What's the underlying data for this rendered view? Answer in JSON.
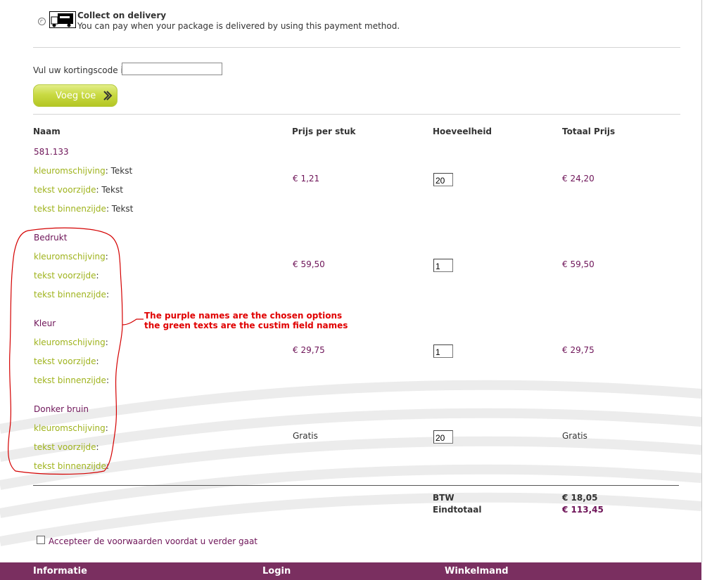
{
  "payment": {
    "title": "Collect on delivery",
    "description": "You can pay when your package is delivered by using this payment method."
  },
  "discount": {
    "label": "Vul uw kortingscode in",
    "value": "",
    "button_label": "Voeg toe"
  },
  "table": {
    "headers": [
      "Naam",
      "Prijs per stuk",
      "Hoeveelheid",
      "Totaal Prijs"
    ],
    "rows": [
      {
        "name": "581.133",
        "fields": [
          {
            "label": "kleuromschijving",
            "value": "Tekst"
          },
          {
            "label": "tekst voorzijde",
            "value": "Tekst"
          },
          {
            "label": "tekst binnenzijde",
            "value": "Tekst"
          }
        ],
        "price": "€ 1,21",
        "qty": "20",
        "total": "€ 24,20"
      },
      {
        "name": "Bedrukt",
        "fields": [
          {
            "label": "kleuromschijving",
            "value": ""
          },
          {
            "label": "tekst voorzijde",
            "value": ""
          },
          {
            "label": "tekst binnenzijde",
            "value": ""
          }
        ],
        "price": "€ 59,50",
        "qty": "1",
        "total": "€ 59,50"
      },
      {
        "name": "Kleur",
        "fields": [
          {
            "label": "kleuromschijving",
            "value": ""
          },
          {
            "label": "tekst voorzijde",
            "value": ""
          },
          {
            "label": "tekst binnenzijde",
            "value": ""
          }
        ],
        "price": "€ 29,75",
        "qty": "1",
        "total": "€ 29,75"
      },
      {
        "name": "Donker bruin",
        "fields": [
          {
            "label": "kleuromschijving",
            "value": ""
          },
          {
            "label": "tekst voorzijde",
            "value": ""
          },
          {
            "label": "tekst binnenzijde",
            "value": ""
          }
        ],
        "price": "Gratis",
        "qty": "20",
        "total": "Gratis"
      }
    ]
  },
  "annotation": {
    "line1": "The purple names are the chosen options",
    "line2": "the green texts are the custim field names"
  },
  "summary": {
    "tax_label": "BTW",
    "tax_value": "€ 18,05",
    "total_label": "Eindtotaal",
    "total_value": "€ 113,45"
  },
  "terms": {
    "label": "Accepteer de voorwaarden voordat u verder gaat"
  },
  "footer": {
    "items": [
      "Informatie",
      "Login",
      "Winkelmand"
    ]
  },
  "colors": {
    "purple": "#6e1458",
    "green": "#9fb31c",
    "footer": "#7a2f60",
    "annotation": "#e00000"
  }
}
